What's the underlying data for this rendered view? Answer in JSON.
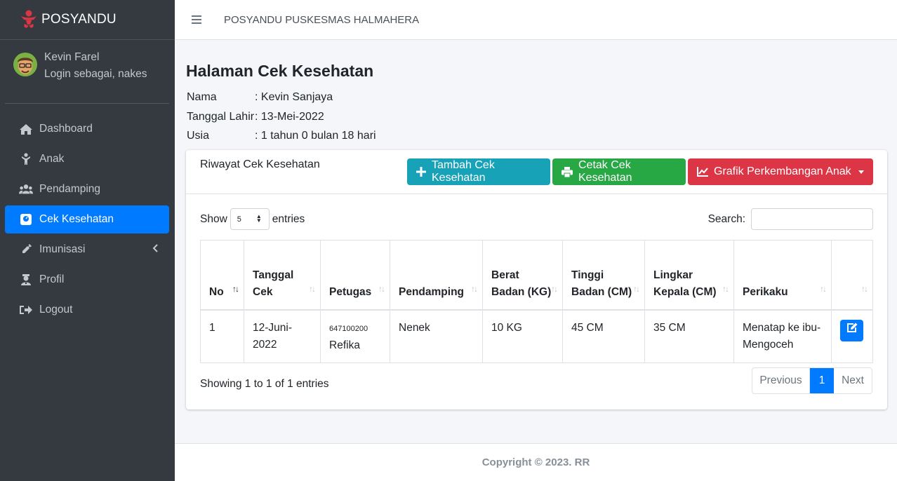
{
  "brand": {
    "name": "POSYANDU",
    "color": "#dc3545"
  },
  "user": {
    "name": "Kevin Farel",
    "role": "Login sebagai, nakes"
  },
  "sidebar": {
    "items": [
      {
        "label": "Dashboard",
        "icon": "home-icon"
      },
      {
        "label": "Anak",
        "icon": "child-icon"
      },
      {
        "label": "Pendamping",
        "icon": "users-icon"
      },
      {
        "label": "Cek Kesehatan",
        "icon": "scale-icon",
        "active": true
      },
      {
        "label": "Imunisasi",
        "icon": "syringe-icon",
        "has_submenu": true
      },
      {
        "label": "Profil",
        "icon": "user-nurse-icon"
      },
      {
        "label": "Logout",
        "icon": "sign-out-icon"
      }
    ]
  },
  "header": {
    "title": "POSYANDU PUSKESMAS HALMAHERA"
  },
  "page": {
    "title": "Halaman Cek Kesehatan",
    "info": [
      {
        "label": "Nama",
        "value": ": Kevin Sanjaya"
      },
      {
        "label": "Tanggal Lahir",
        "value": ": 13-Mei-2022"
      },
      {
        "label": "Usia",
        "value": ": 1 tahun 0 bulan 18 hari"
      }
    ]
  },
  "card": {
    "title": "Riwayat Cek Kesehatan",
    "buttons": {
      "add": "Tambah Cek Kesehatan",
      "print": "Cetak Cek Kesehatan",
      "chart": "Grafik Perkembangan Anak"
    },
    "colors": {
      "teal": "#17a2b8",
      "green": "#28a745",
      "red": "#dc3545"
    }
  },
  "table": {
    "show_label": "Show",
    "entries_label": "entries",
    "page_size": "5",
    "search_label": "Search:",
    "columns": [
      "No",
      "Tanggal Cek",
      "Petugas",
      "Pendamping",
      "Berat Badan (KG)",
      "Tinggi Badan (CM)",
      "Lingkar Kepala (CM)",
      "Perikaku",
      ""
    ],
    "rows": [
      {
        "no": "1",
        "tanggal": "12-Juni-2022",
        "petugas_id": "647100200",
        "petugas_name": "Refika",
        "pendamping": "Nenek",
        "berat": "10 KG",
        "tinggi": "45 CM",
        "lingkar": "35 CM",
        "perilaku": "Menatap ke ibu-Mengoceh"
      }
    ],
    "showing": "Showing 1 to 1 of 1 entries",
    "pager": {
      "prev": "Previous",
      "current": "1",
      "next": "Next"
    }
  },
  "footer": {
    "text": "Copyright © 2023. RR"
  }
}
